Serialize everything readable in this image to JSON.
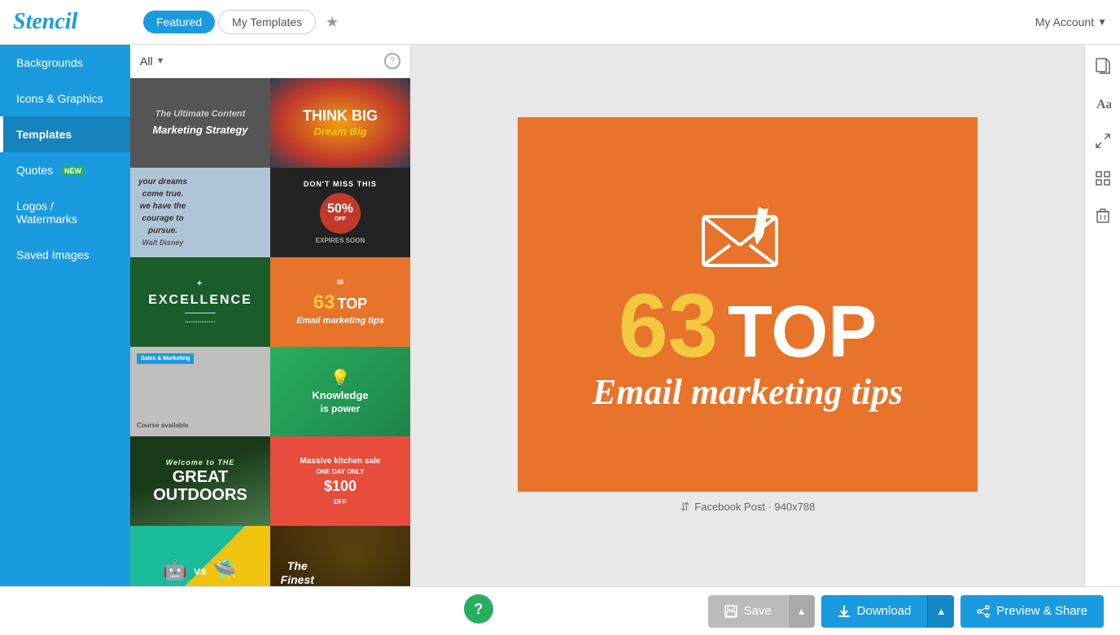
{
  "topbar": {
    "logo": "Stencil",
    "tabs": [
      {
        "label": "Featured",
        "id": "featured",
        "active": true
      },
      {
        "label": "My Templates",
        "id": "my-templates",
        "active": false
      }
    ],
    "account_label": "My Account"
  },
  "sidebar": {
    "items": [
      {
        "label": "Backgrounds",
        "id": "backgrounds",
        "active": false
      },
      {
        "label": "Icons & Graphics",
        "id": "icons-graphics",
        "active": false
      },
      {
        "label": "Templates",
        "id": "templates",
        "active": true
      },
      {
        "label": "Quotes",
        "id": "quotes",
        "active": false,
        "badge": "NEW"
      },
      {
        "label": "Logos / Watermarks",
        "id": "logos-watermarks",
        "active": false
      },
      {
        "label": "Saved Images",
        "id": "saved-images",
        "active": false
      }
    ]
  },
  "filter": {
    "label": "All"
  },
  "canvas": {
    "num": "63",
    "top": "TOP",
    "subtitle": "Email marketing tips",
    "label": "Facebook Post · 940x788"
  },
  "bottom": {
    "save_label": "Save",
    "download_label": "Download",
    "preview_label": "Preview & Share"
  },
  "templates": [
    {
      "text": "The Ultimate Content Marketing Strategy",
      "bg": "#555",
      "row": 0,
      "col": 0
    },
    {
      "text": "THINK BIG Dream Big",
      "bg": "#c0392b",
      "row": 0,
      "col": 1
    },
    {
      "text": "Your dreams can come true...",
      "bg": "#87ceeb",
      "row": 1,
      "col": 0
    },
    {
      "text": "DON'T MISS THIS 50% OFF",
      "bg": "#333",
      "row": 1,
      "col": 1
    },
    {
      "text": "EXCELLENCE",
      "bg": "#1a5c2a",
      "row": 2,
      "col": 0
    },
    {
      "text": "63 TOP Email marketing tips",
      "bg": "#e8732a",
      "row": 2,
      "col": 1
    },
    {
      "text": "Sales & Marketing Course",
      "bg": "#bbb",
      "row": 3,
      "col": 0
    },
    {
      "text": "Knowledge is power",
      "bg": "#27ae60",
      "row": 3,
      "col": 1
    },
    {
      "text": "Welcome to THE GREAT OUTDOORS",
      "bg": "#2c5f2e",
      "row": 4,
      "col": 0
    },
    {
      "text": "Massive kitchen sale ONE DAY ONLY $100 OFF",
      "bg": "#e74c3c",
      "row": 4,
      "col": 1
    },
    {
      "text": "vs (characters)",
      "bg": "#1abc9c",
      "row": 5,
      "col": 0
    },
    {
      "text": "The Finest Blends. Columbian.",
      "bg": "#7f4f24",
      "row": 5,
      "col": 1
    }
  ]
}
